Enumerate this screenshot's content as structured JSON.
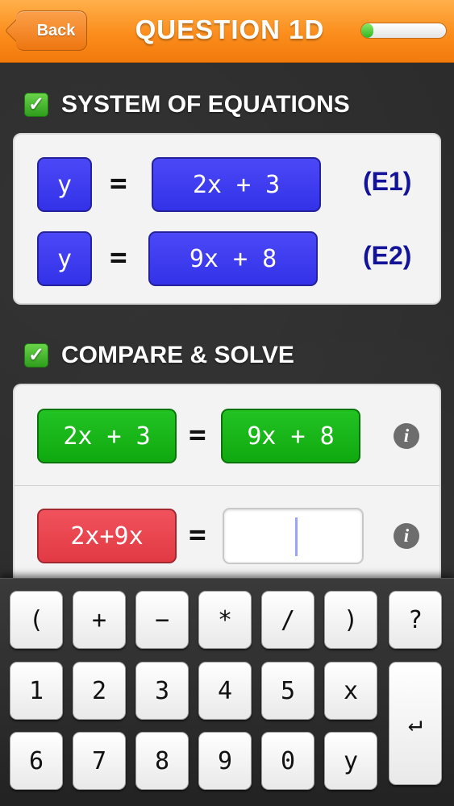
{
  "header": {
    "back_label": "Back",
    "title": "QUESTION 1D",
    "progress": 0.14
  },
  "sections": {
    "system": {
      "check": "✓",
      "title": "SYSTEM OF EQUATIONS"
    },
    "compare": {
      "check": "✓",
      "title": "COMPARE & SOLVE"
    }
  },
  "equations": {
    "e1": {
      "left": "y",
      "op": "=",
      "right": "2x + 3",
      "label": "(E1)"
    },
    "e2": {
      "left": "y",
      "op": "=",
      "right": "9x + 8",
      "label": "(E2)"
    }
  },
  "solve": {
    "row1": {
      "left": "2x + 3",
      "op": "=",
      "right": "9x + 8",
      "info": "i"
    },
    "row2": {
      "left": "2x+9x",
      "op": "=",
      "input_value": "",
      "info": "i"
    }
  },
  "keyboard": {
    "row1": [
      "(",
      "+",
      "−",
      "*",
      "/",
      ")",
      "?"
    ],
    "row2": [
      "1",
      "2",
      "3",
      "4",
      "5",
      "x"
    ],
    "row3": [
      "6",
      "7",
      "8",
      "9",
      "0",
      "y"
    ],
    "enter": "↵"
  },
  "colors": {
    "header": "#fb8d1c",
    "blue_tile": "#3a38ee",
    "green_tile": "#16b016",
    "red_tile": "#e8444d",
    "label": "#13139a"
  }
}
